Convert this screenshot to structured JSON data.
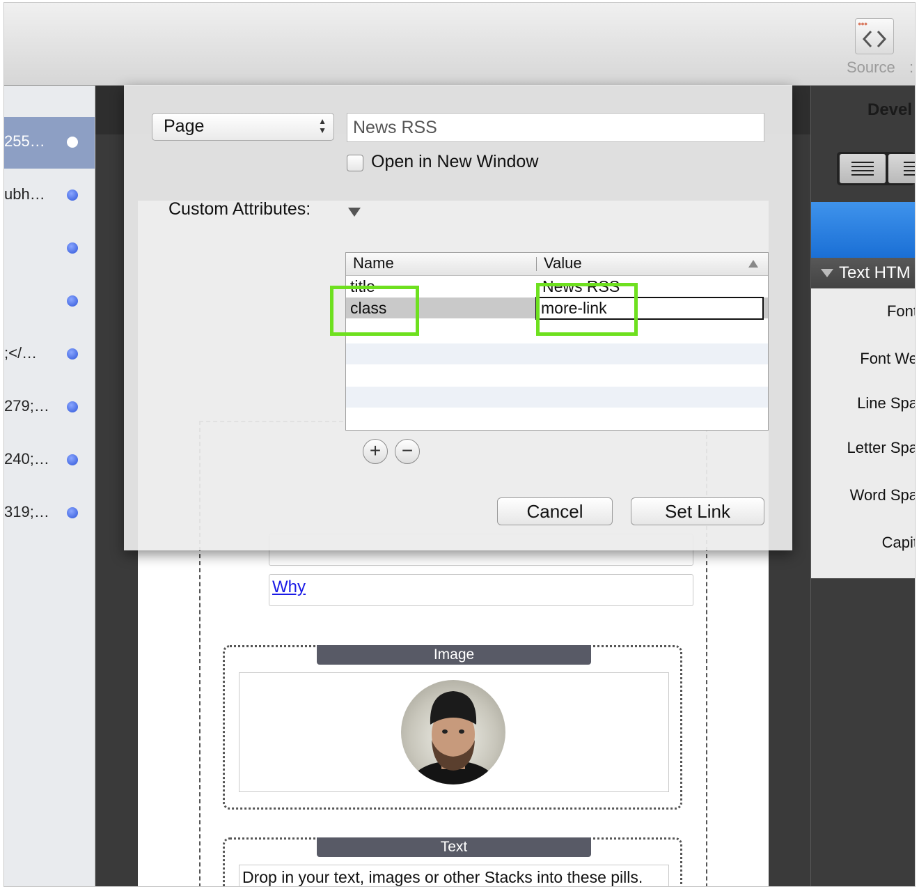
{
  "toolbar": {
    "source_label": "Source",
    "source_extra": ":"
  },
  "left_list": {
    "items": [
      {
        "text": "255…",
        "selected": true
      },
      {
        "text": "ubh…",
        "selected": false
      },
      {
        "text": "",
        "selected": false
      },
      {
        "text": "",
        "selected": false
      },
      {
        "text": ";</…",
        "selected": false
      },
      {
        "text": "279;…",
        "selected": false
      },
      {
        "text": "240;…",
        "selected": false
      },
      {
        "text": "319;…",
        "selected": false
      }
    ]
  },
  "right_panel": {
    "header": "Devel",
    "section_title": "Text HTM",
    "properties": [
      "Font",
      "Font We",
      "Line Spa",
      "Letter Spa",
      "Word Spa",
      "Capit"
    ]
  },
  "page": {
    "links": [
      "Why"
    ],
    "image_pill": "Image",
    "text_pill": "Text",
    "text_body": "Drop in your text, images or other Stacks into these pills."
  },
  "dialog": {
    "link_type": "Page",
    "link_value": "News RSS",
    "open_new_window_label": "Open in New Window",
    "open_new_window_checked": false,
    "custom_attributes_label": "Custom Attributes:",
    "table": {
      "columns": [
        "Name",
        "Value"
      ],
      "rows": [
        {
          "name": "title",
          "value": "News RSS"
        },
        {
          "name": "class",
          "value": "more-link",
          "selected": true
        }
      ]
    },
    "add_glyph": "+",
    "remove_glyph": "−",
    "cancel_label": "Cancel",
    "set_link_label": "Set Link"
  },
  "colors": {
    "highlight": "#6ee01f",
    "selection_row": "#8d9fc4",
    "blue_dot": "#2f56d8",
    "panel_blue": "#1a6fd5"
  }
}
